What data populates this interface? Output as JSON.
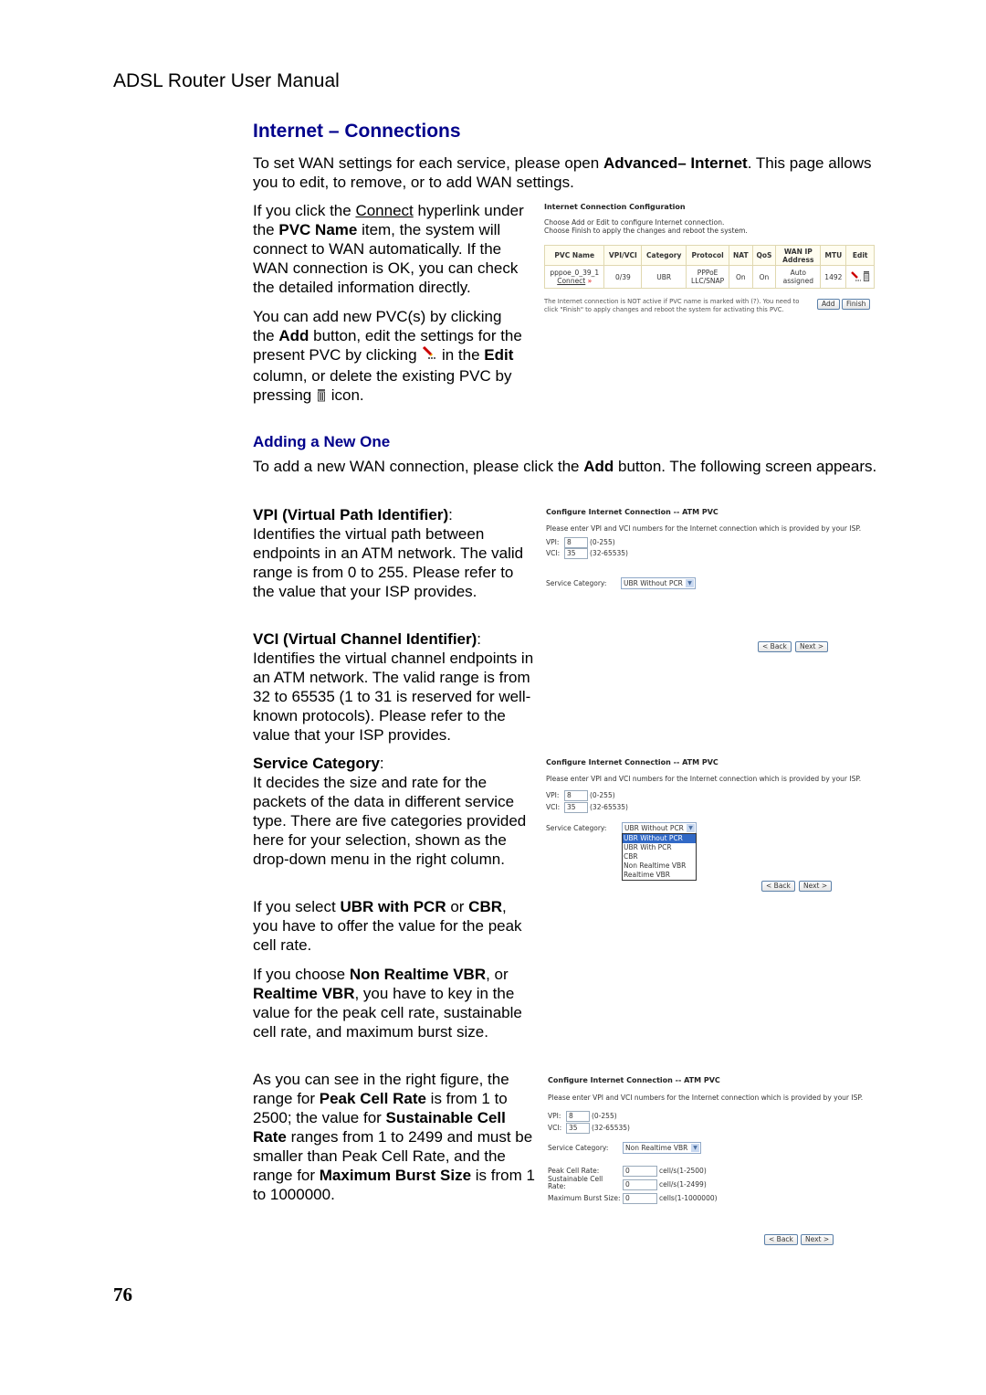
{
  "manual_title": "ADSL Router User Manual",
  "section_title": "Internet – Connections",
  "intro": {
    "p1": "To set WAN settings for each service, please open ",
    "p1_bold": "Advanced– Internet",
    "p2": ". This page allows you to edit, to remove, or to add WAN settings."
  },
  "connect_paragraph": {
    "a": "If you click the ",
    "link": "Connect",
    "b": " hyperlink under the ",
    "bold": "PVC Name",
    "c": " item, the system will connect to WAN automatically. If the WAN connection is OK, you can check the detailed information directly."
  },
  "add_paragraph": {
    "a": "You can add new PVC(s) by clicking the ",
    "bold1": "Add",
    "b": " button, edit the settings for the present PVC by clicking ",
    "c": " in the ",
    "bold2": "Edit",
    "d": " column, or delete the existing PVC by pressing ",
    "e": " icon."
  },
  "adding_new_heading": "Adding a New One",
  "adding_new_text": {
    "a": "To add a new WAN connection, please click the ",
    "bold": "Add",
    "b": " button. The following screen appears."
  },
  "vpi_section": {
    "title": "VPI (Virtual Path Identifier)",
    "colon": ":",
    "text": "Identifies the virtual path between endpoints in an ATM network. The valid range is from 0 to 255. Please refer to the value that your ISP provides."
  },
  "vci_section": {
    "title": "VCI (Virtual Channel Identifier)",
    "colon": ":",
    "text": "Identifies the virtual channel endpoints in an ATM network. The valid range is from 32 to 65535 (1 to 31 is reserved for well-known protocols). Please refer to the value that your ISP provides."
  },
  "service_category_section": {
    "title": "Service Category",
    "colon": ":",
    "text": "It decides the size and rate for the packets of the data in different service type. There are five categories provided here for your selection, shown as the drop-down menu in the right column."
  },
  "pcr_paragraph": {
    "a": "If you select ",
    "bold1": "UBR with PCR",
    "b": " or ",
    "bold2": "CBR",
    "c": ", you have to offer the value for the peak cell rate."
  },
  "vbr_paragraph": {
    "a": "If you choose ",
    "bold1": "Non Realtime VBR",
    "b": ", or ",
    "bold2": "Realtime VBR",
    "c": ", you have to key in the value for the peak cell rate, sustainable cell rate, and maximum burst size."
  },
  "range_paragraph": {
    "a": "As you can see in the right figure, the range for ",
    "bold1": "Peak Cell Rate",
    "b": " is from 1 to 2500; the value for ",
    "bold2": "Sustainable Cell Rate",
    "c": " ranges from 1 to 2499 and must be smaller than Peak Cell Rate, and the range for ",
    "bold3": "Maximum Burst Size",
    "d": " is from 1 to 1000000."
  },
  "page_number": "76",
  "screenshot_config": {
    "title": "Internet Connection Configuration",
    "line1": "Choose Add or Edit to configure Internet connection.",
    "line2": "Choose Finish to apply the changes and reboot the system.",
    "headers": [
      "PVC Name",
      "VPI/VCI",
      "Category",
      "Protocol",
      "NAT",
      "QoS",
      "WAN IP Address",
      "MTU",
      "Edit"
    ],
    "row": {
      "pvc_name": "pppoe_0_39_1",
      "connect_link": "Connect",
      "vpi_vci": "0/39",
      "category": "UBR",
      "protocol": "PPPoE LLC/SNAP",
      "nat": "On",
      "qos": "On",
      "wan_ip": "Auto assigned",
      "mtu": "1492"
    },
    "note": "The Internet connection is NOT active if PVC name is marked with (?). You need to click \"Finish\" to apply changes and reboot the system for activating this PVC.",
    "add_button": "Add",
    "finish_button": "Finish"
  },
  "screenshot_atm": {
    "title": "Configure Internet Connection -- ATM PVC",
    "instruction": "Please enter VPI and VCI numbers for the Internet connection which is provided by your ISP.",
    "vpi_label": "VPI:",
    "vpi_value": "8",
    "vpi_range": "(0-255)",
    "vci_label": "VCI:",
    "vci_value": "35",
    "vci_range": "(32-65535)",
    "service_category_label": "Service Category:",
    "back_button": "< Back",
    "next_button": "Next >"
  },
  "screenshot1": {
    "selected": "UBR Without PCR"
  },
  "screenshot2": {
    "selected": "UBR Without PCR",
    "options": [
      "UBR Without PCR",
      "UBR With PCR",
      "CBR",
      "Non Realtime VBR",
      "Realtime VBR"
    ]
  },
  "screenshot3": {
    "selected": "Non Realtime VBR",
    "peak_cell_rate_label": "Peak Cell Rate:",
    "peak_cell_rate_value": "0",
    "peak_cell_rate_unit": "cell/s(1-2500)",
    "sustainable_label": "Sustainable Cell Rate:",
    "sustainable_value": "0",
    "sustainable_unit": "cell/s(1-2499)",
    "max_burst_label": "Maximum Burst Size:",
    "max_burst_value": "0",
    "max_burst_unit": "cells(1-1000000)"
  }
}
